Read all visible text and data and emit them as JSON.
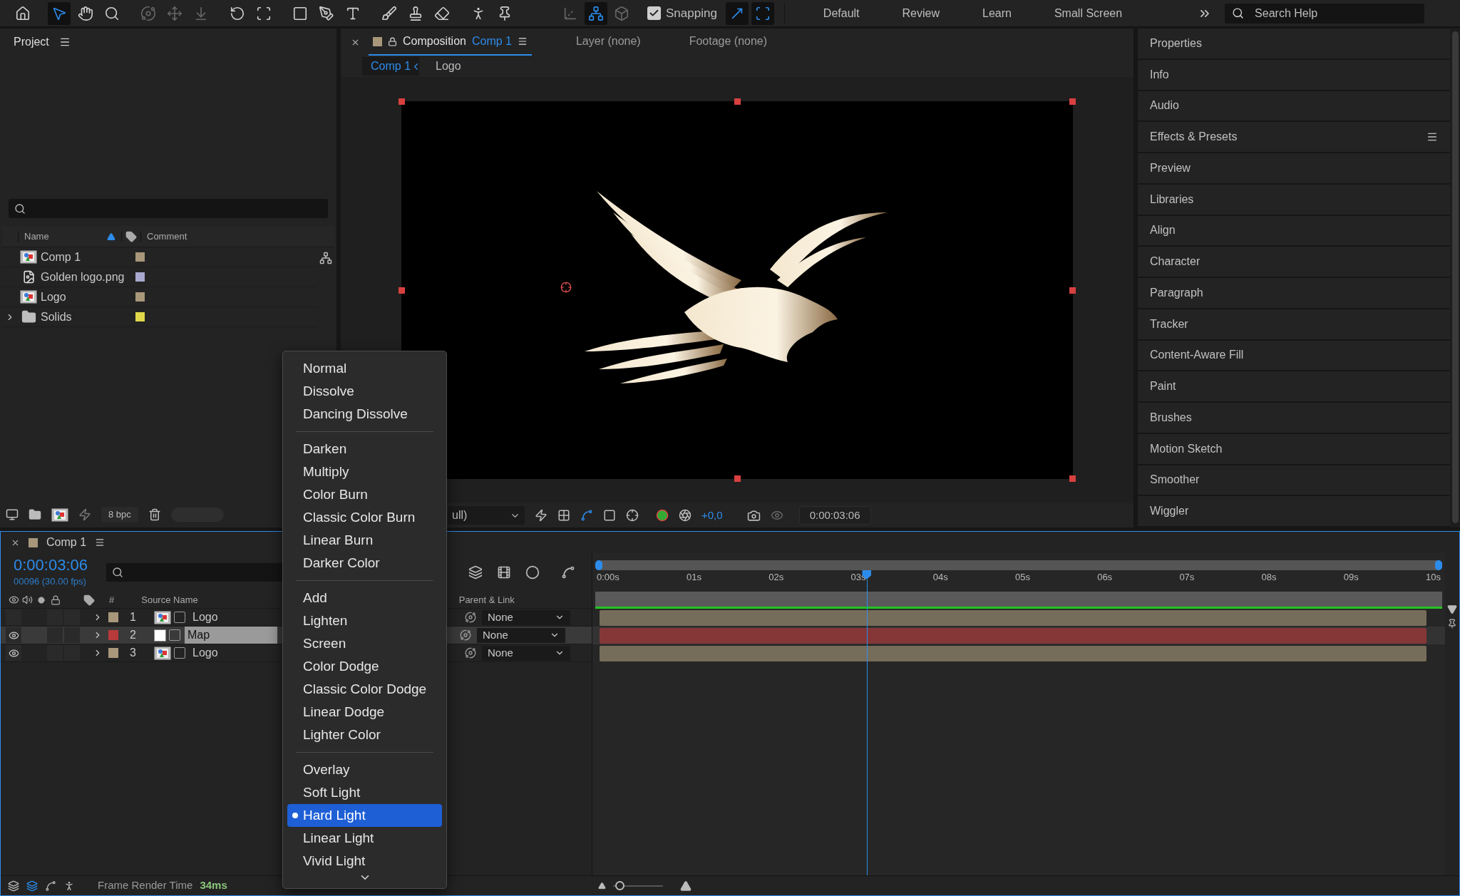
{
  "toolbar": {
    "tools": [
      {
        "kind": "home",
        "selected": false,
        "disabled": false
      },
      {
        "kind": "select",
        "selected": true,
        "disabled": false
      },
      {
        "kind": "hand",
        "selected": false,
        "disabled": false
      },
      {
        "kind": "zoom",
        "selected": false,
        "disabled": false
      },
      {
        "kind": "orbit",
        "selected": false,
        "disabled": true
      },
      {
        "kind": "move",
        "selected": false,
        "disabled": true
      },
      {
        "kind": "dolly",
        "selected": false,
        "disabled": true
      },
      {
        "kind": "rotate",
        "selected": false,
        "disabled": false
      },
      {
        "kind": "region",
        "selected": false,
        "disabled": false
      },
      {
        "kind": "rectangle",
        "selected": false,
        "disabled": false
      },
      {
        "kind": "pen",
        "selected": false,
        "disabled": false
      },
      {
        "kind": "text",
        "selected": false,
        "disabled": false
      },
      {
        "kind": "brush",
        "selected": false,
        "disabled": false
      },
      {
        "kind": "stamp",
        "selected": false,
        "disabled": false
      },
      {
        "kind": "eraser",
        "selected": false,
        "disabled": false
      },
      {
        "kind": "roto",
        "selected": false,
        "disabled": false
      },
      {
        "kind": "puppet",
        "selected": false,
        "disabled": false
      }
    ],
    "axis_tools": [
      {
        "kind": "local",
        "selected": false
      },
      {
        "kind": "world",
        "selected": true
      },
      {
        "kind": "view",
        "selected": false
      }
    ],
    "snapping": {
      "label": "Snapping",
      "checked": true
    },
    "snap_options": [
      {
        "kind": "edges",
        "selected": true
      },
      {
        "kind": "features",
        "selected": true
      }
    ],
    "workspaces": [
      "Default",
      "Review",
      "Learn",
      "Small Screen"
    ],
    "search": {
      "placeholder": "Search Help"
    }
  },
  "project": {
    "title": "Project",
    "columns": [
      "Name",
      "Comment"
    ],
    "items": [
      {
        "name": "Comp 1",
        "kind": "comp",
        "color": "#a8977a",
        "expandable": false
      },
      {
        "name": "Golden logo.png",
        "kind": "image",
        "color": "#a8a8d0",
        "expandable": false
      },
      {
        "name": "Logo",
        "kind": "comp",
        "color": "#a8977a",
        "expandable": false
      },
      {
        "name": "Solids",
        "kind": "folder",
        "color": "#e0d84a",
        "expandable": true
      }
    ],
    "bpc": "8 bpc"
  },
  "viewer": {
    "tabs": [
      {
        "prefix": "Composition",
        "name": "Comp 1",
        "selected": true
      },
      {
        "prefix": "Layer (none)",
        "selected": false
      },
      {
        "prefix": "Footage (none)",
        "selected": false
      }
    ],
    "breadcrumbs": [
      {
        "label": "Comp 1",
        "selected": true
      },
      {
        "label": "Logo",
        "selected": false
      }
    ],
    "resolution": "ull)",
    "exposure": "+0,0",
    "timecode": "0:00:03:06"
  },
  "panels": [
    {
      "label": "Properties",
      "menu": false
    },
    {
      "label": "Info",
      "menu": false
    },
    {
      "label": "Audio",
      "menu": false
    },
    {
      "label": "Effects & Presets",
      "menu": true
    },
    {
      "label": "Preview",
      "menu": false
    },
    {
      "label": "Libraries",
      "menu": false
    },
    {
      "label": "Align",
      "menu": false
    },
    {
      "label": "Character",
      "menu": false
    },
    {
      "label": "Paragraph",
      "menu": false
    },
    {
      "label": "Tracker",
      "menu": false
    },
    {
      "label": "Content-Aware Fill",
      "menu": false
    },
    {
      "label": "Paint",
      "menu": false
    },
    {
      "label": "Brushes",
      "menu": false
    },
    {
      "label": "Motion Sketch",
      "menu": false
    },
    {
      "label": "Smoother",
      "menu": false
    },
    {
      "label": "Wiggler",
      "menu": false
    }
  ],
  "timeline": {
    "title": "Comp 1",
    "timecode": "0:00:03:06",
    "frame_info": "00096 (30.00 fps)",
    "columns": {
      "number": "#",
      "source": "Source Name",
      "parent": "Parent & Link"
    },
    "ruler": [
      "0:00s",
      "01s",
      "02s",
      "03s",
      "04s",
      "05s",
      "06s",
      "07s",
      "08s",
      "09s",
      "10s"
    ],
    "playhead": {
      "level": 0.323
    },
    "zoom": {
      "level": 0.05
    },
    "layers": [
      {
        "number": "1",
        "name": "Logo",
        "kind": "comp",
        "color": "#a8977a",
        "visible": false,
        "selected": false,
        "parent": "None"
      },
      {
        "number": "2",
        "name": "Map",
        "kind": "solid",
        "color": "#b83a3a",
        "visible": true,
        "selected": true,
        "parent": "None"
      },
      {
        "number": "3",
        "name": "Logo",
        "kind": "comp",
        "color": "#a8977a",
        "visible": true,
        "selected": false,
        "parent": "None"
      }
    ]
  },
  "status_bar": {
    "label": "Frame Render Time",
    "value": "34ms"
  },
  "blend_menu": {
    "groups": [
      [
        {
          "label": "Normal",
          "selected": false
        },
        {
          "label": "Dissolve",
          "selected": false
        },
        {
          "label": "Dancing Dissolve",
          "selected": false
        }
      ],
      [
        {
          "label": "Darken",
          "selected": false
        },
        {
          "label": "Multiply",
          "selected": false
        },
        {
          "label": "Color Burn",
          "selected": false
        },
        {
          "label": "Classic Color Burn",
          "selected": false
        },
        {
          "label": "Linear Burn",
          "selected": false
        },
        {
          "label": "Darker Color",
          "selected": false
        }
      ],
      [
        {
          "label": "Add",
          "selected": false
        },
        {
          "label": "Lighten",
          "selected": false
        },
        {
          "label": "Screen",
          "selected": false
        },
        {
          "label": "Color Dodge",
          "selected": false
        },
        {
          "label": "Classic Color Dodge",
          "selected": false
        },
        {
          "label": "Linear Dodge",
          "selected": false
        },
        {
          "label": "Lighter Color",
          "selected": false
        }
      ],
      [
        {
          "label": "Overlay",
          "selected": false
        },
        {
          "label": "Soft Light",
          "selected": false
        },
        {
          "label": "Hard Light",
          "selected": true
        },
        {
          "label": "Linear Light",
          "selected": false
        },
        {
          "label": "Vivid Light",
          "selected": false
        }
      ]
    ]
  }
}
